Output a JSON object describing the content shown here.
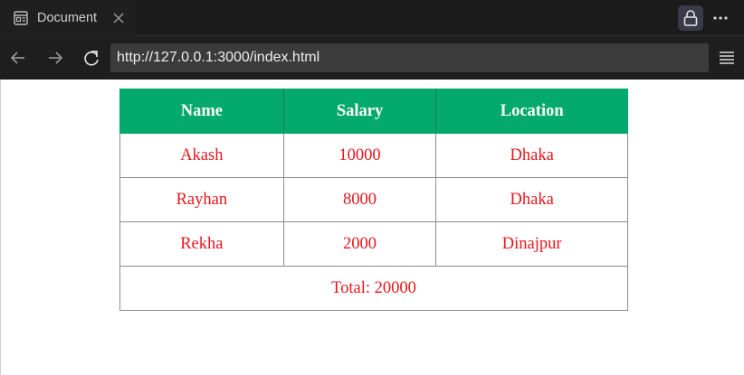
{
  "browser": {
    "tab_title": "Document",
    "url": "http://127.0.0.1:3000/index.html"
  },
  "icons": {
    "tab": "page-icon",
    "close": "close-icon",
    "lock": "lock-icon",
    "more": "more-dots-icon",
    "back": "arrow-left-icon",
    "forward": "arrow-right-icon",
    "reload": "reload-icon",
    "menu": "hamburger-menu-icon"
  },
  "colors": {
    "header_bg": "#04a96d",
    "header_text": "#ffffff",
    "cell_text": "#e8161c"
  },
  "table": {
    "headers": [
      "Name",
      "Salary",
      "Location"
    ],
    "rows": [
      [
        "Akash",
        "10000",
        "Dhaka"
      ],
      [
        "Rayhan",
        "8000",
        "Dhaka"
      ],
      [
        "Rekha",
        "2000",
        "Dinajpur"
      ]
    ],
    "total": "Total: 20000"
  }
}
